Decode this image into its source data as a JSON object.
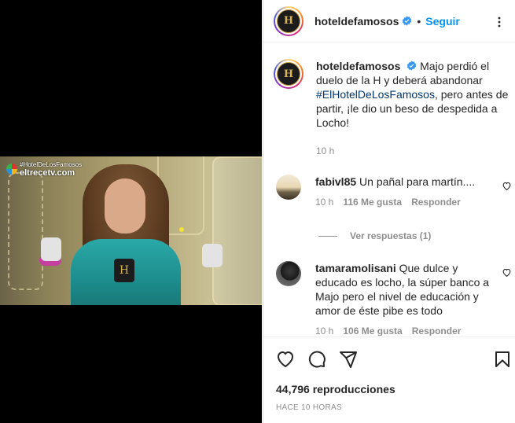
{
  "post": {
    "username": "hotelde­famosos",
    "follow_label": "Seguir",
    "dot": "•",
    "avatar_letter": "H"
  },
  "video": {
    "watermark_line1": "#HotelDeLosFamosos",
    "watermark_line2": "eltrecetv.com",
    "shirt_letter": "H"
  },
  "caption": {
    "username": "hoteldefamosos",
    "text_before": "Majo perdió el duelo de la H y deberá abandonar ",
    "hashtag": "#ElHotelDeLosFamosos",
    "text_after": ", pero antes de partir, ¡le dio un beso de despedida a Locho!",
    "time": "10 h"
  },
  "comments": [
    {
      "username": "fabivl85",
      "text": "Un pañal para martín....",
      "time": "10 h",
      "likes": "116 Me gusta",
      "reply_label": "Responder"
    },
    {
      "username": "tamaramolisani",
      "text": "Que dulce y educado es locho, la súper banco a Majo pero el nivel de educación y amor de éste pibe es todo",
      "time": "10 h",
      "likes": "106 Me gusta",
      "reply_label": "Responder"
    }
  ],
  "view_replies": "Ver respuestas (1)",
  "footer": {
    "views": "44,796 reproducciones",
    "ago": "HACE 10 HORAS"
  },
  "icons": {
    "verified": "verified-badge-icon",
    "more": "more-options-icon",
    "like": "heart-icon",
    "comment": "comment-icon",
    "share": "share-icon",
    "save": "bookmark-icon"
  },
  "colors": {
    "link": "#0095f6",
    "hashtag": "#00376b",
    "muted": "#8e8e8e"
  }
}
